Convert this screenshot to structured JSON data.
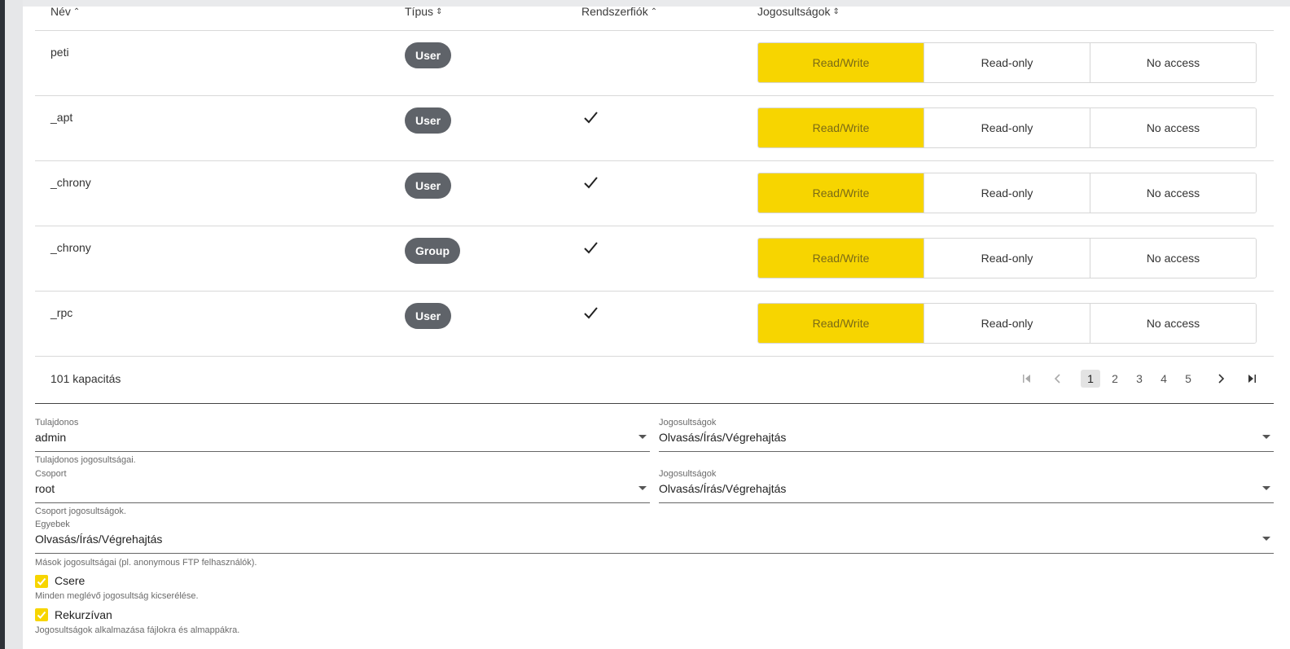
{
  "columns": {
    "name": "Név",
    "type": "Típus",
    "system": "Rendszerfiók",
    "perms": "Jogosultságok"
  },
  "segment_labels": [
    "Read/Write",
    "Read-only",
    "No access"
  ],
  "rows": [
    {
      "name": "peti",
      "type": "User",
      "system": false
    },
    {
      "name": "_apt",
      "type": "User",
      "system": true
    },
    {
      "name": "_chrony",
      "type": "User",
      "system": true
    },
    {
      "name": "_chrony",
      "type": "Group",
      "system": true
    },
    {
      "name": "_rpc",
      "type": "User",
      "system": true
    }
  ],
  "footer": {
    "count": "101 kapacitás",
    "pages": [
      "1",
      "2",
      "3",
      "4",
      "5"
    ],
    "current_page": "1"
  },
  "form": {
    "owner_label": "Tulajdonos",
    "owner_value": "admin",
    "owner_perm_label": "Jogosultságok",
    "owner_perm_value": "Olvasás/Írás/Végrehajtás",
    "owner_hint": "Tulajdonos jogosultságai.",
    "group_label": "Csoport",
    "group_value": "root",
    "group_perm_label": "Jogosultságok",
    "group_perm_value": "Olvasás/Írás/Végrehajtás",
    "group_hint": "Csoport jogosultságok.",
    "others_label": "Egyebek",
    "others_value": "Olvasás/Írás/Végrehajtás",
    "others_hint": "Mások jogosultságai (pl. anonymous FTP felhasználók).",
    "replace_label": "Csere",
    "replace_hint": "Minden meglévő jogosultság kicserélése.",
    "recursive_label": "Rekurzívan",
    "recursive_hint": "Jogosultságok alkalmazása fájlokra és almappákra."
  },
  "colors": {
    "accent": "#f7d500",
    "badge": "#5f6369"
  }
}
